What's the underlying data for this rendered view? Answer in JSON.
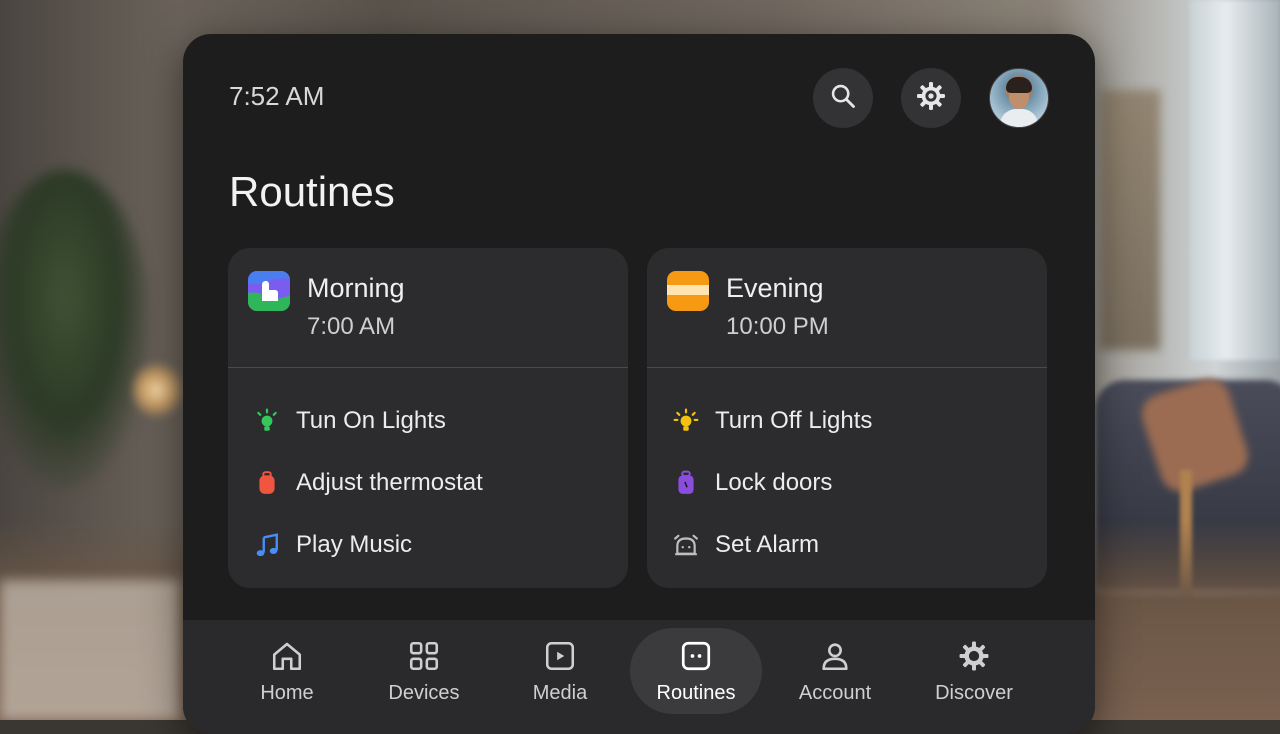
{
  "status": {
    "time": "7:52 AM"
  },
  "header": {
    "search_icon": "search-icon",
    "settings_icon": "gear-icon",
    "avatar": "avatar"
  },
  "page": {
    "title": "Routines"
  },
  "routines": [
    {
      "name": "Morning",
      "time": "7:00 AM",
      "icon": "morning-routine-icon",
      "actions": [
        {
          "label": "Tun On Lights",
          "icon": "lightbulb-icon",
          "color": "#34c759"
        },
        {
          "label": "Adjust thermostat",
          "icon": "thermostat-icon",
          "color": "#f0563f"
        },
        {
          "label": "Play Music",
          "icon": "music-note-icon",
          "color": "#4a8df6"
        }
      ]
    },
    {
      "name": "Evening",
      "time": "10:00 PM",
      "icon": "evening-routine-icon",
      "actions": [
        {
          "label": "Turn Off Lights",
          "icon": "lightbulb-icon",
          "color": "#f4c20d"
        },
        {
          "label": "Lock doors",
          "icon": "lock-icon",
          "color": "#8a4dde"
        },
        {
          "label": "Set Alarm",
          "icon": "alarm-icon",
          "color": "#bfbfbf"
        }
      ]
    }
  ],
  "nav": {
    "items": [
      {
        "label": "Home",
        "icon": "home-icon"
      },
      {
        "label": "Devices",
        "icon": "devices-grid-icon"
      },
      {
        "label": "Media",
        "icon": "media-icon"
      },
      {
        "label": "Routines",
        "icon": "routines-icon",
        "active": true
      },
      {
        "label": "Account",
        "icon": "account-icon"
      },
      {
        "label": "Discover",
        "icon": "discover-gear-icon"
      }
    ]
  }
}
